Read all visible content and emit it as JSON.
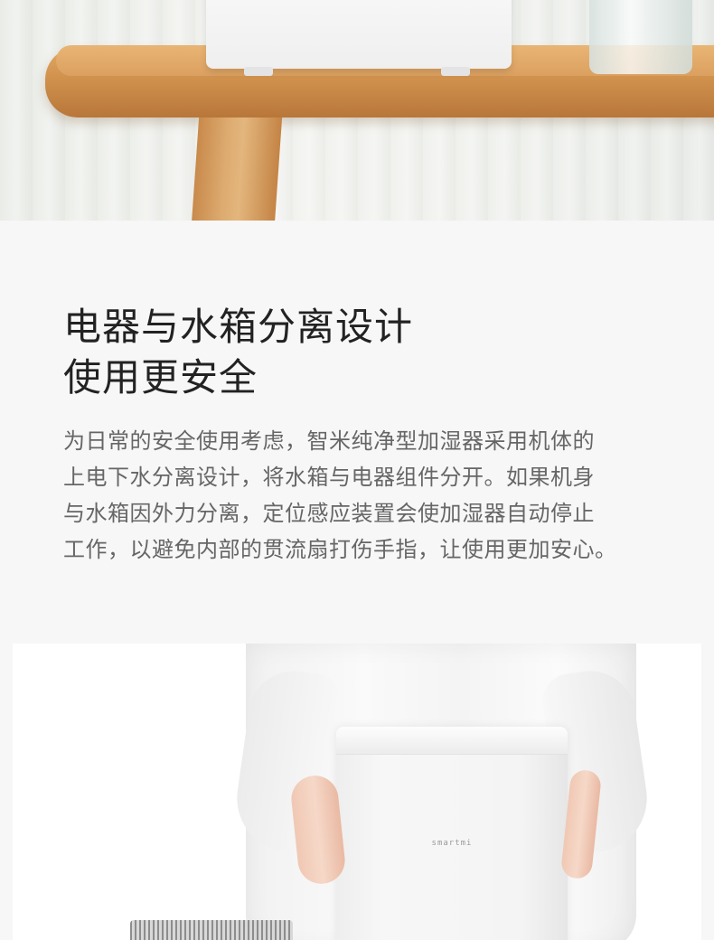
{
  "hero_image": {
    "alt": "humidifier-on-wooden-shelf"
  },
  "section": {
    "headline_lines": [
      "电器与水箱分离设计",
      "使用更安全"
    ],
    "body_lines": [
      "为日常的安全使用考虑，智米纯净型加湿器采用机体的",
      "上电下水分离设计，将水箱与电器组件分开。如果机身",
      "与水箱因外力分离，定位感应装置会使加湿器自动停止",
      "工作，以避免内部的贯流扇打伤手指，让使用更加安心。"
    ]
  },
  "product_photo": {
    "brand_label": "smartmi"
  },
  "colors": {
    "headline": "#222222",
    "body": "#666666",
    "background": "#f7f7f7",
    "wood": "#d99d5e"
  }
}
